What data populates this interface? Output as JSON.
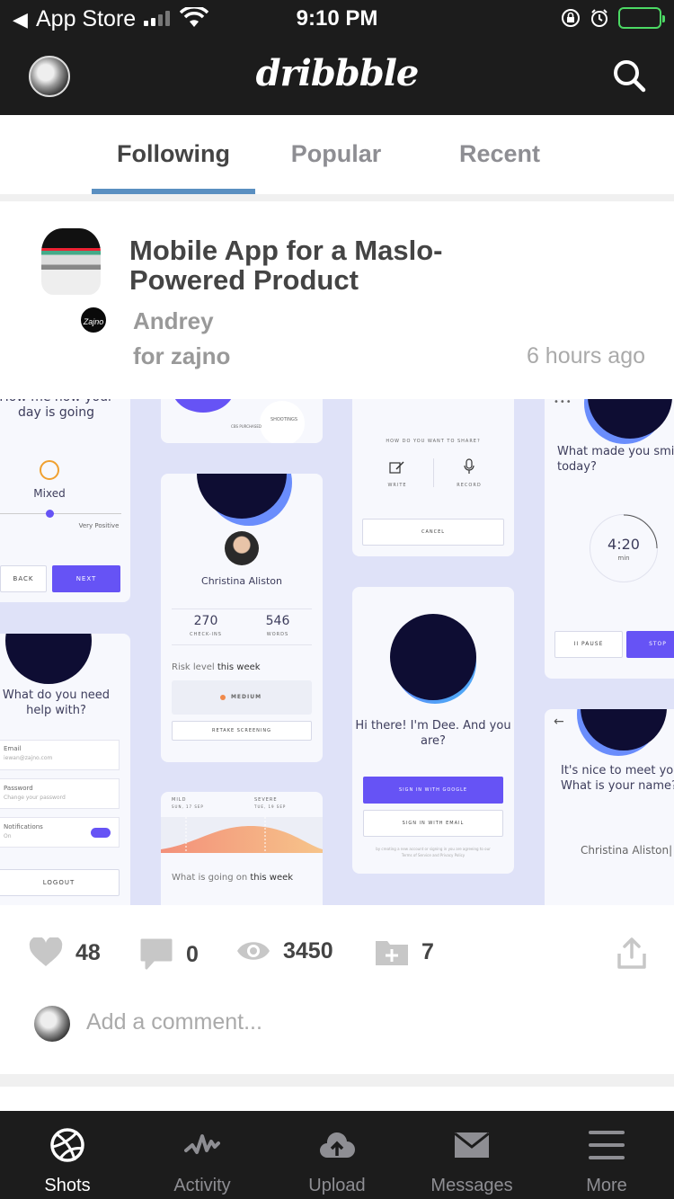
{
  "status_bar": {
    "back_glyph": "◀",
    "back_app": "App Store",
    "time": "9:10 PM",
    "battery_color": "#4cd964"
  },
  "header": {
    "logo": "dribbble",
    "avatar_icon": "user-avatar",
    "search_icon": "search-icon"
  },
  "tabs": [
    {
      "label": "Following",
      "active": true
    },
    {
      "label": "Popular",
      "active": false
    },
    {
      "label": "Recent",
      "active": false
    }
  ],
  "post": {
    "title": "Mobile App for a Maslo-Powered Product",
    "author": "Andrey",
    "team": "for zajno",
    "time": "6 hours ago",
    "team_badge": "Zajno"
  },
  "shot": {
    "card1": {
      "question": "How me how your day is going",
      "mood": "Mixed",
      "slider_label": "Very Positive",
      "back": "BACK",
      "next": "NEXT"
    },
    "card2": {
      "question": "What do you need help with?",
      "items": [
        {
          "label": "Email",
          "value": "iewan@zajno.com"
        },
        {
          "label": "Password",
          "value": "Change your password"
        },
        {
          "label": "Notifications",
          "value": "On"
        }
      ],
      "logout": "LOGOUT"
    },
    "card3": {
      "purchased": "CBS PURCHASED",
      "shootings": "SHOOTINGS"
    },
    "card4": {
      "name": "Christina Aliston",
      "checkins": "270",
      "checkins_label": "CHECK-INS",
      "words": "546",
      "words_label": "WORDS",
      "risk_a": "Risk level",
      "risk_b": "this week",
      "risk_value": "MEDIUM",
      "retake": "RETAKE SCREENING"
    },
    "card5": {
      "mild": "MILD",
      "mild_date": "SUN, 17 SEP",
      "severe": "SEVERE",
      "severe_date": "TUE, 19 SEP",
      "question_a": "What is going on",
      "question_b": "this week"
    },
    "card6": {
      "question": "HOW DO YOU WANT TO SHARE?",
      "write": "WRITE",
      "record": "RECORD",
      "cancel": "CANCEL"
    },
    "card7": {
      "greeting": "Hi there! I'm Dee. And you are?",
      "google": "SIGN IN WITH GOOGLE",
      "email": "SIGN IN WITH EMAIL",
      "terms": "by creating a new account or signing in you are agreeing to our Terms of Service and Privacy Policy"
    },
    "card8": {
      "question": "What made you smile today?",
      "timer": "4:20",
      "timer_unit": "min",
      "pause": "II PAUSE",
      "stop": "STOP"
    },
    "card9": {
      "question": "It's nice to meet you. What is your name?",
      "name": "Christina Aliston|"
    }
  },
  "stats": {
    "likes": "48",
    "comments": "0",
    "views": "3450",
    "buckets": "7"
  },
  "comment": {
    "placeholder": "Add a comment..."
  },
  "tabbar": [
    {
      "label": "Shots",
      "icon": "dribbble-ball-icon",
      "active": true
    },
    {
      "label": "Activity",
      "icon": "activity-icon",
      "active": false
    },
    {
      "label": "Upload",
      "icon": "upload-cloud-icon",
      "active": false
    },
    {
      "label": "Messages",
      "icon": "envelope-icon",
      "active": false
    },
    {
      "label": "More",
      "icon": "menu-icon",
      "active": false
    }
  ]
}
